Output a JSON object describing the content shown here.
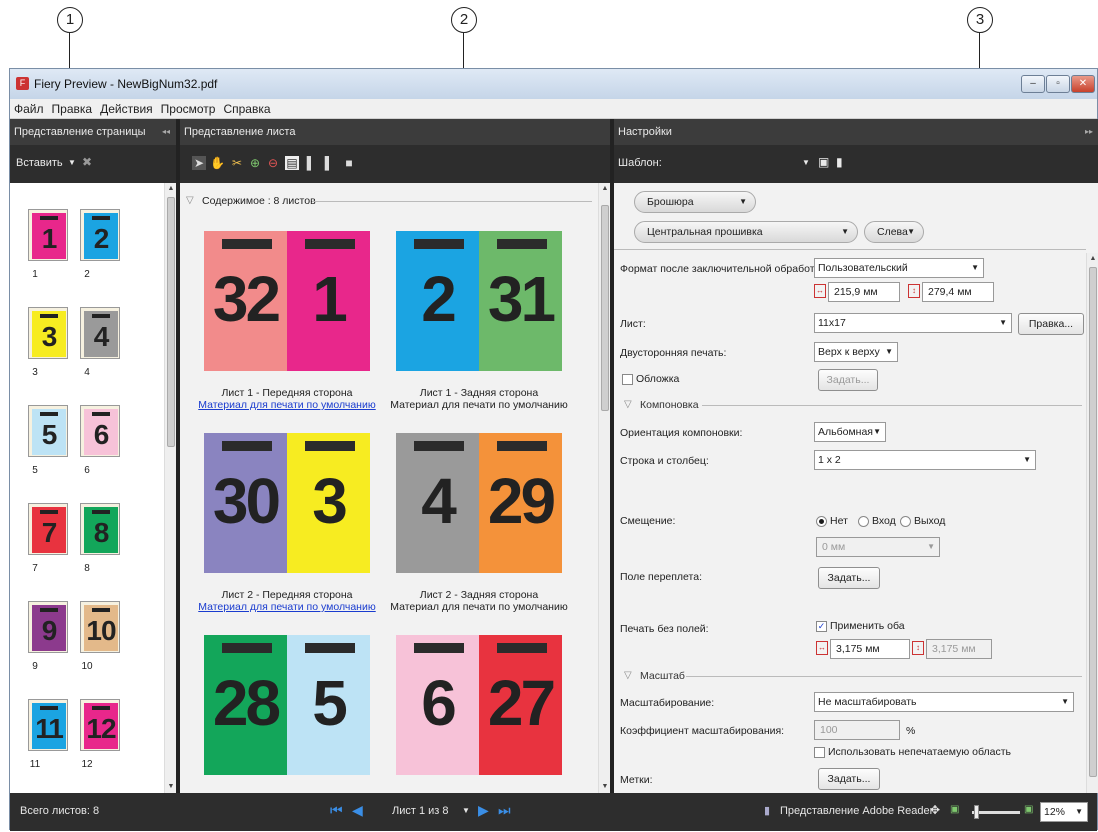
{
  "callouts": [
    "1",
    "2",
    "3"
  ],
  "window": {
    "title": "Fiery Preview - NewBigNum32.pdf",
    "min": "–",
    "max": "▫",
    "close": "✕"
  },
  "menu": [
    "Файл",
    "Правка",
    "Действия",
    "Просмотр",
    "Справка"
  ],
  "page_view": {
    "title": "Представление страницы",
    "collapse": "◂◂",
    "insert_label": "Вставить"
  },
  "sheet_view": {
    "title": "Представление листа"
  },
  "settings": {
    "title": "Настройки",
    "expand": "▸▸",
    "template_label": "Шаблон:"
  },
  "thumbs": [
    {
      "n": "1",
      "color": "#e8278b"
    },
    {
      "n": "2",
      "color": "#1ba4e2"
    },
    {
      "n": "3",
      "color": "#f7ec21"
    },
    {
      "n": "4",
      "color": "#9a9a9a"
    },
    {
      "n": "5",
      "color": "#bde3f5"
    },
    {
      "n": "6",
      "color": "#f7c2d8"
    },
    {
      "n": "7",
      "color": "#e8333f"
    },
    {
      "n": "8",
      "color": "#13a65a"
    },
    {
      "n": "9",
      "color": "#8c3a8d"
    },
    {
      "n": "10",
      "color": "#e3b98a"
    },
    {
      "n": "11",
      "color": "#1ba4e2"
    },
    {
      "n": "12",
      "color": "#e8278b"
    }
  ],
  "contents_header": "Содержимое : 8 листов",
  "sheets": [
    {
      "left": {
        "n": "32",
        "color": "#f28b8b"
      },
      "right": {
        "n": "1",
        "color": "#e8278b"
      },
      "caption": "Лист 1 - Передняя сторона",
      "media": "Материал для печати по умолчанию",
      "media_link": true
    },
    {
      "left": {
        "n": "2",
        "color": "#1ba4e2"
      },
      "right": {
        "n": "31",
        "color": "#6db96a"
      },
      "caption": "Лист 1 - Задняя сторона",
      "media": "Материал для печати по умолчанию",
      "media_link": false
    },
    {
      "left": {
        "n": "30",
        "color": "#8a84c0"
      },
      "right": {
        "n": "3",
        "color": "#f7ec21"
      },
      "caption": "Лист 2 - Передняя сторона",
      "media": "Материал для печати по умолчанию",
      "media_link": true
    },
    {
      "left": {
        "n": "4",
        "color": "#9a9a9a"
      },
      "right": {
        "n": "29",
        "color": "#f4923a"
      },
      "caption": "Лист 2 - Задняя сторона",
      "media": "Материал для печати по умолчанию",
      "media_link": false
    },
    {
      "left": {
        "n": "28",
        "color": "#13a65a"
      },
      "right": {
        "n": "5",
        "color": "#bde3f5"
      },
      "caption": "",
      "media": "",
      "media_link": false
    },
    {
      "left": {
        "n": "6",
        "color": "#f7c2d8"
      },
      "right": {
        "n": "27",
        "color": "#e8333f"
      },
      "caption": "",
      "media": "",
      "media_link": false
    }
  ],
  "form": {
    "booklet": "Брошюра",
    "binding": "Центральная прошивка",
    "side": "Слева",
    "finished_size_label": "Формат после заключительной обработки:",
    "finished_size": "Пользовательский",
    "width": "215,9 мм",
    "height": "279,4 мм",
    "sheet_label": "Лист:",
    "sheet": "11x17",
    "edit_btn": "Правка...",
    "duplex_label": "Двусторонняя печать:",
    "duplex": "Верх к верху",
    "cover_label": "Обложка",
    "define_btn": "Задать...",
    "layout_section": "Компоновка",
    "orientation_label": "Ориентация компоновки:",
    "orientation": "Альбомная",
    "rowcol_label": "Строка и столбец:",
    "rowcol": "1 x 2",
    "shift_label": "Смещение:",
    "shift_none": "Нет",
    "shift_in": "Вход",
    "shift_out": "Выход",
    "shift_value": "0 мм",
    "gutter_label": "Поле переплета:",
    "bleed_label": "Печать без полей:",
    "apply_both": "Применить оба",
    "bleed1": "3,175 мм",
    "bleed2": "3,175 мм",
    "scale_section": "Масштаб",
    "scaling_label": "Масштабирование:",
    "scaling": "Не масштабировать",
    "factor_label": "Коэффициент масштабирования:",
    "factor": "100",
    "percent": "%",
    "nonprint": "Использовать непечатаемую область",
    "marks_label": "Метки:"
  },
  "status": {
    "total": "Всего листов: 8",
    "page": "Лист 1 из 8",
    "adobe": "Представление Adobe Reader",
    "zoom": "12%"
  }
}
